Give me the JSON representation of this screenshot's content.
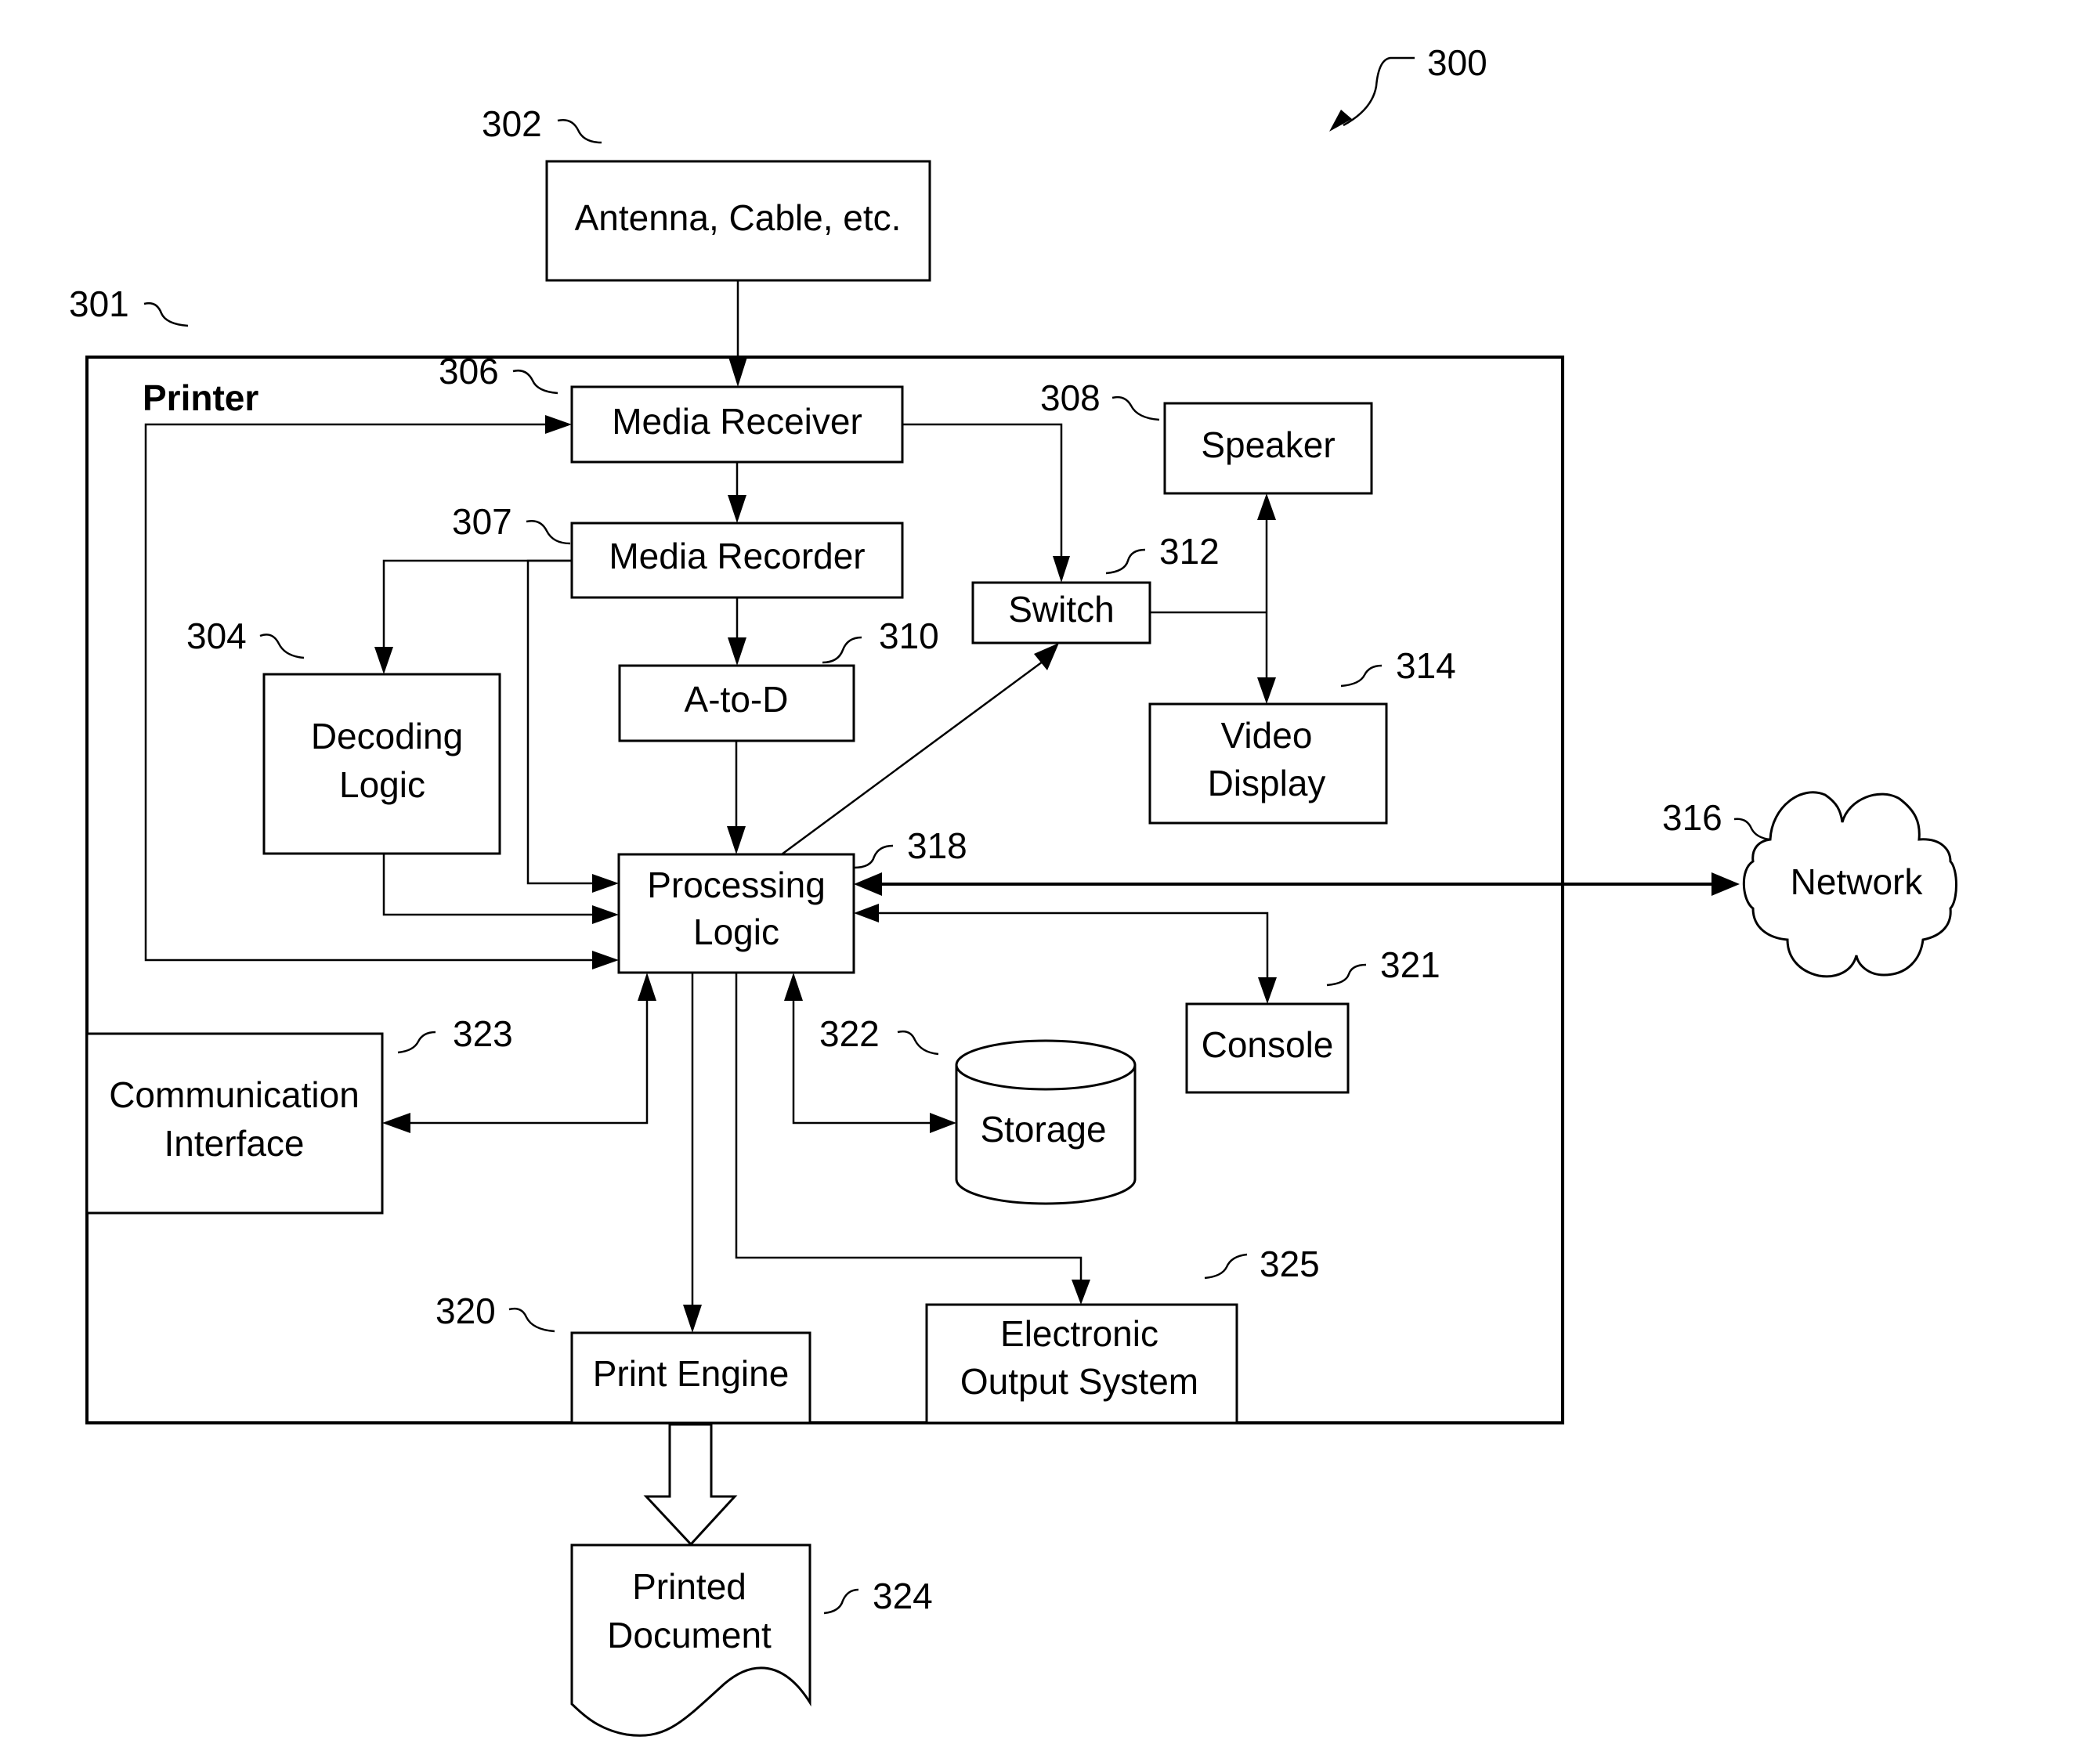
{
  "figure": {
    "reference": "300",
    "system_reference": "301",
    "container_title": "Printer"
  },
  "blocks": {
    "antenna": {
      "ref": "302",
      "label": "Antenna, Cable, etc."
    },
    "decoding_logic": {
      "ref": "304",
      "label_line1": "Decoding",
      "label_line2": "Logic"
    },
    "media_receiver": {
      "ref": "306",
      "label": "Media Receiver"
    },
    "media_recorder": {
      "ref": "307",
      "label": "Media Recorder"
    },
    "speaker": {
      "ref": "308",
      "label": "Speaker"
    },
    "a_to_d": {
      "ref": "310",
      "label": "A-to-D"
    },
    "switch": {
      "ref": "312",
      "label": "Switch"
    },
    "video_display": {
      "ref": "314",
      "label_line1": "Video",
      "label_line2": "Display"
    },
    "network": {
      "ref": "316",
      "label": "Network"
    },
    "processing_logic": {
      "ref": "318",
      "label_line1": "Processing",
      "label_line2": "Logic"
    },
    "print_engine": {
      "ref": "320",
      "label": "Print Engine"
    },
    "console": {
      "ref": "321",
      "label": "Console"
    },
    "storage": {
      "ref": "322",
      "label": "Storage"
    },
    "communication_interface": {
      "ref": "323",
      "label_line1": "Communication",
      "label_line2": "Interface"
    },
    "printed_document": {
      "ref": "324",
      "label_line1": "Printed",
      "label_line2": "Document"
    },
    "electronic_output": {
      "ref": "325",
      "label_line1": "Electronic",
      "label_line2": "Output System"
    }
  },
  "connections": [
    {
      "from": "Antenna, Cable, etc.",
      "to": "Media Receiver",
      "direction": "one-way"
    },
    {
      "from": "Media Receiver",
      "to": "Media Recorder",
      "direction": "one-way"
    },
    {
      "from": "Media Receiver",
      "to": "Switch",
      "direction": "one-way"
    },
    {
      "from": "Media Recorder",
      "to": "Decoding Logic",
      "direction": "one-way"
    },
    {
      "from": "Media Recorder",
      "to": "A-to-D",
      "direction": "one-way"
    },
    {
      "from": "Media Recorder",
      "to": "Processing Logic",
      "direction": "one-way"
    },
    {
      "from": "A-to-D",
      "to": "Processing Logic",
      "direction": "one-way"
    },
    {
      "from": "Decoding Logic",
      "to": "Processing Logic",
      "direction": "one-way"
    },
    {
      "from": "Media Receiver",
      "to": "Processing Logic",
      "direction": "loop"
    },
    {
      "from": "Processing Logic",
      "to": "Switch",
      "direction": "one-way"
    },
    {
      "from": "Switch",
      "to": "Speaker",
      "direction": "one-way"
    },
    {
      "from": "Switch",
      "to": "Video Display",
      "direction": "one-way"
    },
    {
      "from": "Processing Logic",
      "to": "Network",
      "direction": "two-way"
    },
    {
      "from": "Processing Logic",
      "to": "Console",
      "direction": "two-way"
    },
    {
      "from": "Processing Logic",
      "to": "Storage",
      "direction": "two-way"
    },
    {
      "from": "Processing Logic",
      "to": "Communication Interface",
      "direction": "two-way"
    },
    {
      "from": "Processing Logic",
      "to": "Print Engine",
      "direction": "one-way"
    },
    {
      "from": "Processing Logic",
      "to": "Electronic Output System",
      "direction": "one-way"
    },
    {
      "from": "Print Engine",
      "to": "Printed Document",
      "direction": "one-way"
    }
  ]
}
